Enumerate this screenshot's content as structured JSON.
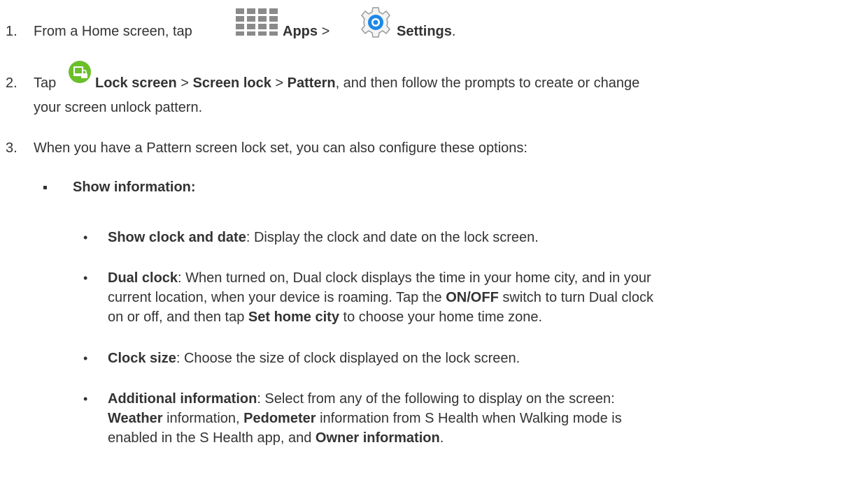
{
  "steps": [
    {
      "number": "1.",
      "prefix": "From a Home screen, tap",
      "apps_label": "Apps",
      "sep": ">",
      "settings_label": "Settings",
      "end": "."
    },
    {
      "number": "2.",
      "prefix": "Tap",
      "lock_screen": "Lock screen",
      "sep1": ">",
      "screen_lock": "Screen lock",
      "sep2": ">",
      "pattern": "Pattern",
      "rest_line1": ", and then follow the prompts to create or change",
      "line2": "your screen unlock pattern."
    },
    {
      "number": "3.",
      "text": "When you have a Pattern screen lock set, you can also configure these options:"
    }
  ],
  "options": {
    "heading": "Show information:",
    "items": [
      {
        "term": "Show clock and date",
        "desc": ": Display the clock and date on the lock screen."
      },
      {
        "term": "Dual clock",
        "desc_l1": ": When turned on, Dual clock displays the time in your home city, and in your",
        "desc_l2_a": "current location, when your device is roaming. Tap the ",
        "onoff": "ON/OFF",
        "desc_l2_b": " switch to turn Dual clock",
        "desc_l3_a": "on or off, and then tap ",
        "set_home": "Set home city",
        "desc_l3_b": " to choose your home time zone."
      },
      {
        "term": "Clock size",
        "desc": ": Choose the size of clock displayed on the lock screen."
      },
      {
        "term": "Additional information",
        "desc_l1": ": Select from any of the following to display on the screen:",
        "weather": "Weather",
        "l2_a": " information, ",
        "pedometer": "Pedometer",
        "l2_b": " information from S Health when Walking mode is",
        "l3_a": "enabled in the S Health app, and ",
        "owner": "Owner information",
        "l3_b": "."
      }
    ]
  },
  "colors": {
    "text": "#333333",
    "apps_icon": "#8a8a8a",
    "settings_icon": "#1e88e5",
    "lock_icon": "#6abf2a"
  }
}
